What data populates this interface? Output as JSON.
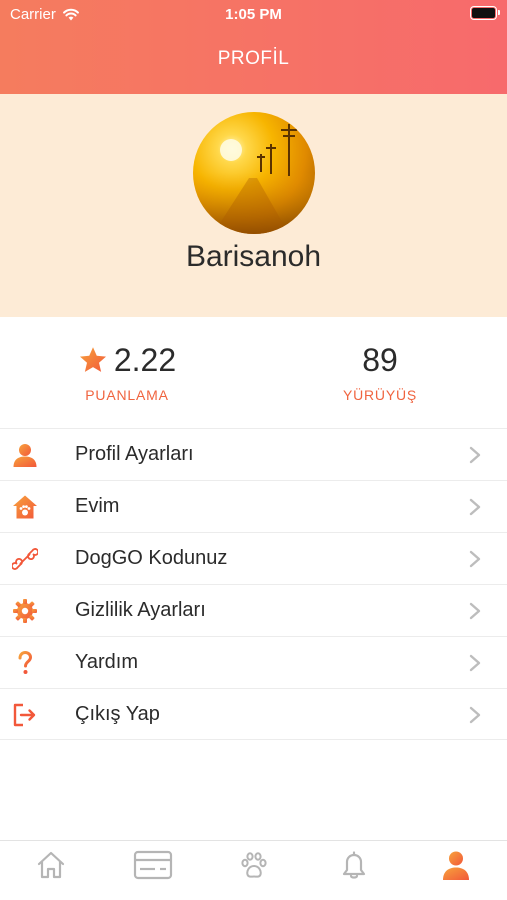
{
  "status_bar": {
    "carrier": "Carrier",
    "time": "1:05 PM"
  },
  "header": {
    "title": "PROFİL"
  },
  "profile": {
    "username": "Barisanoh"
  },
  "stats": {
    "rating": {
      "value": "2.22",
      "label": "PUANLAMA"
    },
    "walks": {
      "value": "89",
      "label": "YÜRÜYÜŞ"
    }
  },
  "menu": {
    "items": [
      {
        "label": "Profil Ayarları",
        "icon": "person-icon"
      },
      {
        "label": "Evim",
        "icon": "home-paw-icon"
      },
      {
        "label": "DogGO Kodunuz",
        "icon": "bone-icon"
      },
      {
        "label": "Gizlilik Ayarları",
        "icon": "gear-icon"
      },
      {
        "label": "Yardım",
        "icon": "question-icon"
      },
      {
        "label": "Çıkış Yap",
        "icon": "logout-icon"
      }
    ]
  },
  "tabbar": {
    "tabs": [
      "home-icon",
      "card-icon",
      "paw-icon",
      "bell-icon",
      "profile-icon"
    ],
    "active": "profile-icon"
  },
  "colors": {
    "accent": "#f0643f",
    "header_start": "#f57c5e",
    "header_end": "#f76a6c",
    "profile_band": "#fdebd6",
    "inactive_tab": "#b5b5b5"
  }
}
